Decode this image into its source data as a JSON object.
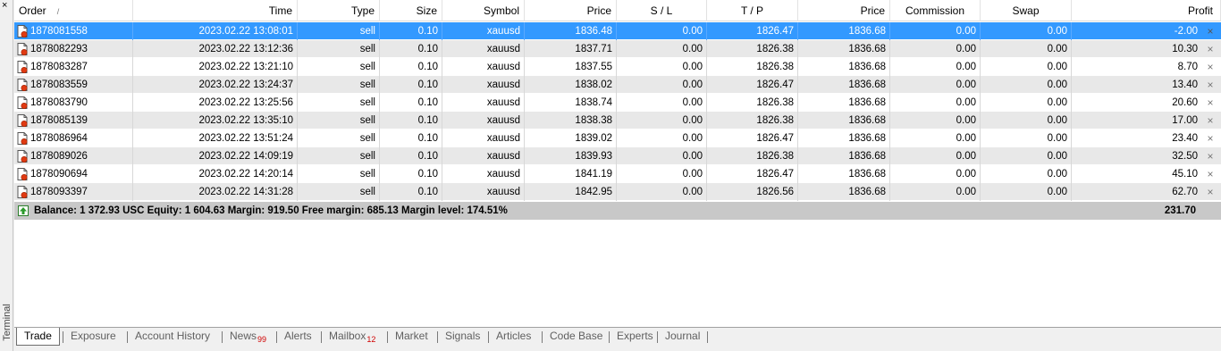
{
  "window": {
    "side_title": "Terminal",
    "close_glyph": "×"
  },
  "columns": [
    "Order",
    "Time",
    "Type",
    "Size",
    "Symbol",
    "Price",
    "S / L",
    "T / P",
    "Price",
    "Commission",
    "Swap",
    "Profit"
  ],
  "sort_indicator": "/",
  "trades": [
    {
      "order": "1878081558",
      "time": "2023.02.22 13:08:01",
      "type": "sell",
      "size": "0.10",
      "symbol": "xauusd",
      "price_open": "1836.48",
      "sl": "0.00",
      "tp": "1826.47",
      "price_cur": "1836.68",
      "commission": "0.00",
      "swap": "0.00",
      "profit": "-2.00"
    },
    {
      "order": "1878082293",
      "time": "2023.02.22 13:12:36",
      "type": "sell",
      "size": "0.10",
      "symbol": "xauusd",
      "price_open": "1837.71",
      "sl": "0.00",
      "tp": "1826.38",
      "price_cur": "1836.68",
      "commission": "0.00",
      "swap": "0.00",
      "profit": "10.30"
    },
    {
      "order": "1878083287",
      "time": "2023.02.22 13:21:10",
      "type": "sell",
      "size": "0.10",
      "symbol": "xauusd",
      "price_open": "1837.55",
      "sl": "0.00",
      "tp": "1826.38",
      "price_cur": "1836.68",
      "commission": "0.00",
      "swap": "0.00",
      "profit": "8.70"
    },
    {
      "order": "1878083559",
      "time": "2023.02.22 13:24:37",
      "type": "sell",
      "size": "0.10",
      "symbol": "xauusd",
      "price_open": "1838.02",
      "sl": "0.00",
      "tp": "1826.47",
      "price_cur": "1836.68",
      "commission": "0.00",
      "swap": "0.00",
      "profit": "13.40"
    },
    {
      "order": "1878083790",
      "time": "2023.02.22 13:25:56",
      "type": "sell",
      "size": "0.10",
      "symbol": "xauusd",
      "price_open": "1838.74",
      "sl": "0.00",
      "tp": "1826.38",
      "price_cur": "1836.68",
      "commission": "0.00",
      "swap": "0.00",
      "profit": "20.60"
    },
    {
      "order": "1878085139",
      "time": "2023.02.22 13:35:10",
      "type": "sell",
      "size": "0.10",
      "symbol": "xauusd",
      "price_open": "1838.38",
      "sl": "0.00",
      "tp": "1826.38",
      "price_cur": "1836.68",
      "commission": "0.00",
      "swap": "0.00",
      "profit": "17.00"
    },
    {
      "order": "1878086964",
      "time": "2023.02.22 13:51:24",
      "type": "sell",
      "size": "0.10",
      "symbol": "xauusd",
      "price_open": "1839.02",
      "sl": "0.00",
      "tp": "1826.47",
      "price_cur": "1836.68",
      "commission": "0.00",
      "swap": "0.00",
      "profit": "23.40"
    },
    {
      "order": "1878089026",
      "time": "2023.02.22 14:09:19",
      "type": "sell",
      "size": "0.10",
      "symbol": "xauusd",
      "price_open": "1839.93",
      "sl": "0.00",
      "tp": "1826.38",
      "price_cur": "1836.68",
      "commission": "0.00",
      "swap": "0.00",
      "profit": "32.50"
    },
    {
      "order": "1878090694",
      "time": "2023.02.22 14:20:14",
      "type": "sell",
      "size": "0.10",
      "symbol": "xauusd",
      "price_open": "1841.19",
      "sl": "0.00",
      "tp": "1826.47",
      "price_cur": "1836.68",
      "commission": "0.00",
      "swap": "0.00",
      "profit": "45.10"
    },
    {
      "order": "1878093397",
      "time": "2023.02.22 14:31:28",
      "type": "sell",
      "size": "0.10",
      "symbol": "xauusd",
      "price_open": "1842.95",
      "sl": "0.00",
      "tp": "1826.56",
      "price_cur": "1836.68",
      "commission": "0.00",
      "swap": "0.00",
      "profit": "62.70"
    }
  ],
  "summary": {
    "text": "Balance: 1 372.93 USC  Equity: 1 604.63  Margin: 919.50  Free margin: 685.13  Margin level: 174.51%",
    "total_profit": "231.70"
  },
  "tabs": [
    {
      "label": "Trade",
      "active": true
    },
    {
      "label": "Exposure"
    },
    {
      "label": "Account History"
    },
    {
      "label": "News",
      "badge": "99"
    },
    {
      "label": "Alerts"
    },
    {
      "label": "Mailbox",
      "badge": "12"
    },
    {
      "label": "Market"
    },
    {
      "label": "Signals"
    },
    {
      "label": "Articles"
    },
    {
      "label": "Code Base"
    },
    {
      "label": "Experts"
    },
    {
      "label": "Journal"
    }
  ],
  "colors": {
    "selected_row": "#3399ff",
    "alt_row": "#e8e8e8",
    "summary_bg": "#c8c8c8",
    "badge": "#d00000"
  }
}
